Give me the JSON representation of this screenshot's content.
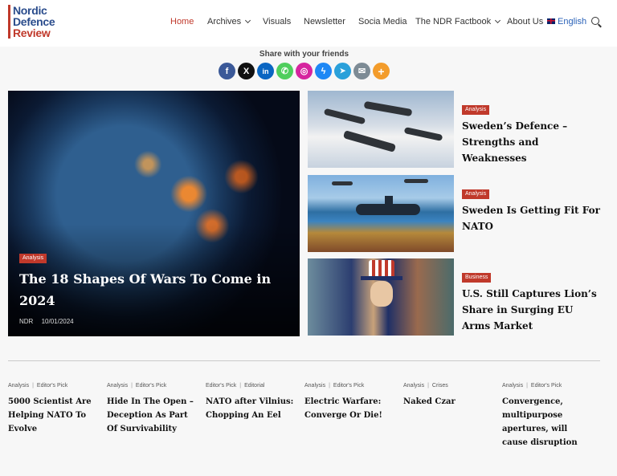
{
  "header": {
    "logo": [
      "Nordic",
      "Defence",
      "Review"
    ],
    "nav": [
      {
        "label": "Home",
        "dropdown": false,
        "active": true
      },
      {
        "label": "Archives",
        "dropdown": true,
        "active": false
      },
      {
        "label": "Visuals",
        "dropdown": false,
        "active": false
      },
      {
        "label": "Newsletter",
        "dropdown": false,
        "active": false
      },
      {
        "label": "Socia Media",
        "dropdown": false,
        "active": false
      },
      {
        "label": "The NDR Factbook",
        "dropdown": true,
        "active": false
      },
      {
        "label": "About Us",
        "dropdown": false,
        "active": false
      }
    ],
    "language": "English",
    "icons": {
      "search": "search-icon",
      "flag": "uk-flag-icon"
    }
  },
  "share": {
    "title": "Share with your friends",
    "buttons": [
      {
        "name": "facebook",
        "glyph": "f",
        "color": "#3b5998"
      },
      {
        "name": "x",
        "glyph": "X",
        "color": "#111111"
      },
      {
        "name": "linkedin",
        "glyph": "in",
        "color": "#0a66c2"
      },
      {
        "name": "whatsapp",
        "glyph": "✆",
        "color": "#4fce5d"
      },
      {
        "name": "instagram",
        "glyph": "◎",
        "color": "#d6249f"
      },
      {
        "name": "messenger",
        "glyph": "ϟ",
        "color": "#1e88f5"
      },
      {
        "name": "telegram",
        "glyph": "➤",
        "color": "#2aa0da"
      },
      {
        "name": "email",
        "glyph": "✉",
        "color": "#7d8b95"
      },
      {
        "name": "more",
        "glyph": "+",
        "color": "#f39c2b"
      }
    ]
  },
  "hero": {
    "category": "Analysis",
    "title": "The 18 Shapes Of Wars To Come in 2024",
    "author": "NDR",
    "date": "10/01/2024"
  },
  "side_articles": [
    {
      "category": "Analysis",
      "title": "Sweden’s Defence – Strengths and Weaknesses",
      "badge_color": "#c0392b"
    },
    {
      "category": "Analysis",
      "title": "Sweden Is Getting Fit For NATO",
      "badge_color": "#c0392b"
    },
    {
      "category": "Business",
      "title": "U.S. Still Captures Lion’s Share in Surging EU Arms Market",
      "badge_color": "#c0392b"
    }
  ],
  "picks": [
    {
      "cats": [
        "Analysis",
        "Editor's Pick"
      ],
      "title": "5000 Scientist Are Helping NATO To Evolve"
    },
    {
      "cats": [
        "Analysis",
        "Editor's Pick"
      ],
      "title": "Hide In The Open – Deception As Part Of Survivability"
    },
    {
      "cats": [
        "Editor's Pick",
        "Editorial"
      ],
      "title": "NATO after Vilnius: Chopping An Eel"
    },
    {
      "cats": [
        "Analysis",
        "Editor's Pick"
      ],
      "title": "Electric Warfare: Converge Or Die!"
    },
    {
      "cats": [
        "Analysis",
        "Crises"
      ],
      "title": "Naked Czar"
    },
    {
      "cats": [
        "Analysis",
        "Editor's Pick"
      ],
      "title": "Convergence, multipurpose apertures, will cause disruption"
    }
  ],
  "colors": {
    "accent": "#c0392b",
    "brand_blue": "#2a4c8c",
    "link_blue": "#2a62b8"
  }
}
